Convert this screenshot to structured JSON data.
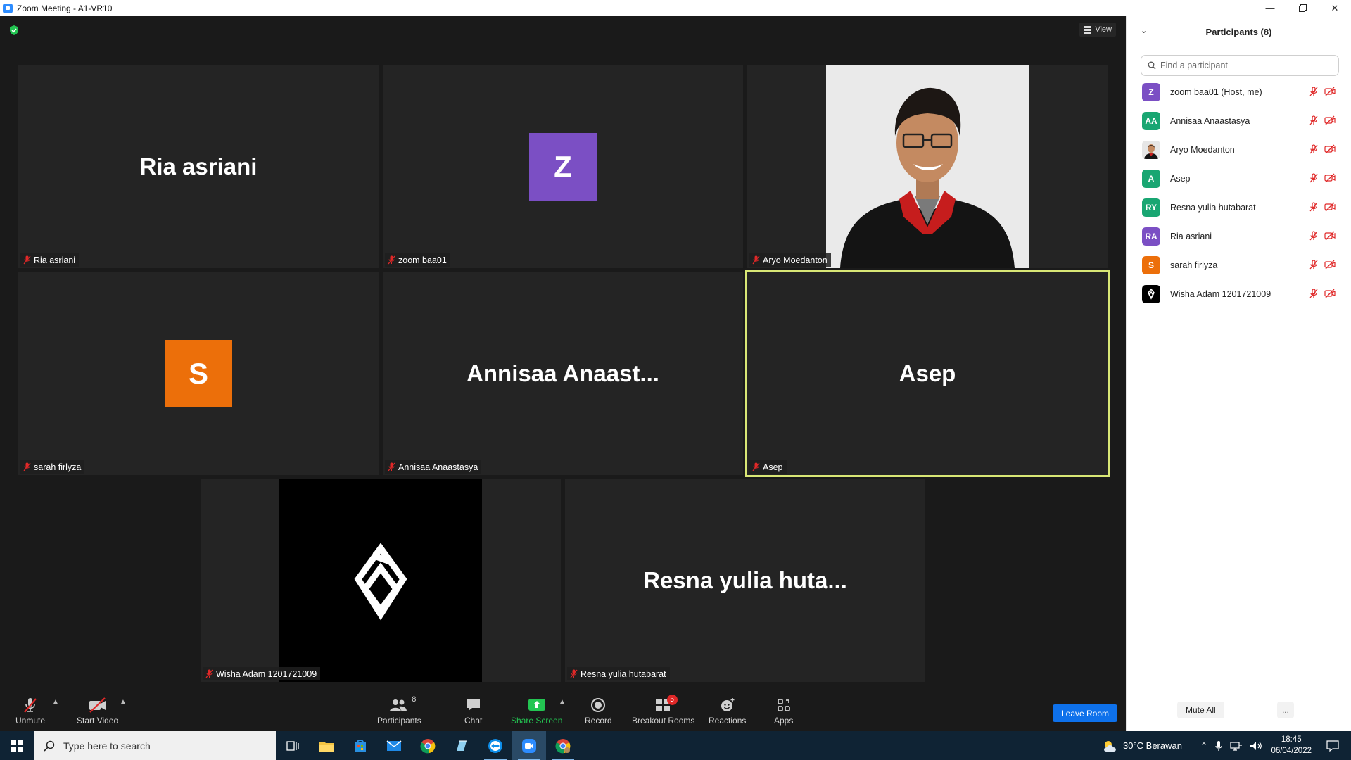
{
  "window": {
    "title": "Zoom Meeting - A1-VR10"
  },
  "meeting": {
    "view_label": "View",
    "tiles": [
      {
        "display": "Ria asriani",
        "tag": "Ria asriani"
      },
      {
        "display": "Z",
        "tag": "zoom baa01",
        "avatar_color": "#7b4fc4"
      },
      {
        "display": "",
        "tag": "Aryo Moedanton"
      },
      {
        "display": "S",
        "tag": "sarah firlyza",
        "avatar_color": "#ec6f0a"
      },
      {
        "display": "Annisaa  Anaast...",
        "tag": "Annisaa Anaastasya"
      },
      {
        "display": "Asep",
        "tag": "Asep"
      },
      {
        "display": "",
        "tag": "Wisha Adam 1201721009"
      },
      {
        "display": "Resna  yulia  huta...",
        "tag": "Resna yulia hutabarat"
      }
    ]
  },
  "toolbar": {
    "unmute": "Unmute",
    "start_video": "Start Video",
    "participants": "Participants",
    "participants_count": "8",
    "chat": "Chat",
    "share_screen": "Share Screen",
    "record": "Record",
    "breakout_rooms": "Breakout Rooms",
    "breakout_badge": "5",
    "reactions": "Reactions",
    "apps": "Apps",
    "leave_room": "Leave Room"
  },
  "panel": {
    "title": "Participants (8)",
    "search_placeholder": "Find a participant",
    "participants": [
      {
        "initials": "Z",
        "name": "zoom baa01 (Host, me)",
        "color": "#7b4fc4"
      },
      {
        "initials": "AA",
        "name": "Annisaa Anaastasya",
        "color": "#19a672"
      },
      {
        "initials": "",
        "name": "Aryo Moedanton",
        "color": "#e6e6e6"
      },
      {
        "initials": "A",
        "name": "Asep",
        "color": "#19a672"
      },
      {
        "initials": "RY",
        "name": "Resna yulia hutabarat",
        "color": "#19a672"
      },
      {
        "initials": "RA",
        "name": "Ria asriani",
        "color": "#7b4fc4"
      },
      {
        "initials": "S",
        "name": "sarah firlyza",
        "color": "#ec6f0a"
      },
      {
        "initials": "",
        "name": "Wisha Adam 1201721009",
        "color": "#000000"
      }
    ],
    "mute_all": "Mute All",
    "more": "..."
  },
  "taskbar": {
    "search_placeholder": "Type here to search",
    "weather": "30°C  Berawan",
    "time": "18:45",
    "date": "06/04/2022"
  }
}
